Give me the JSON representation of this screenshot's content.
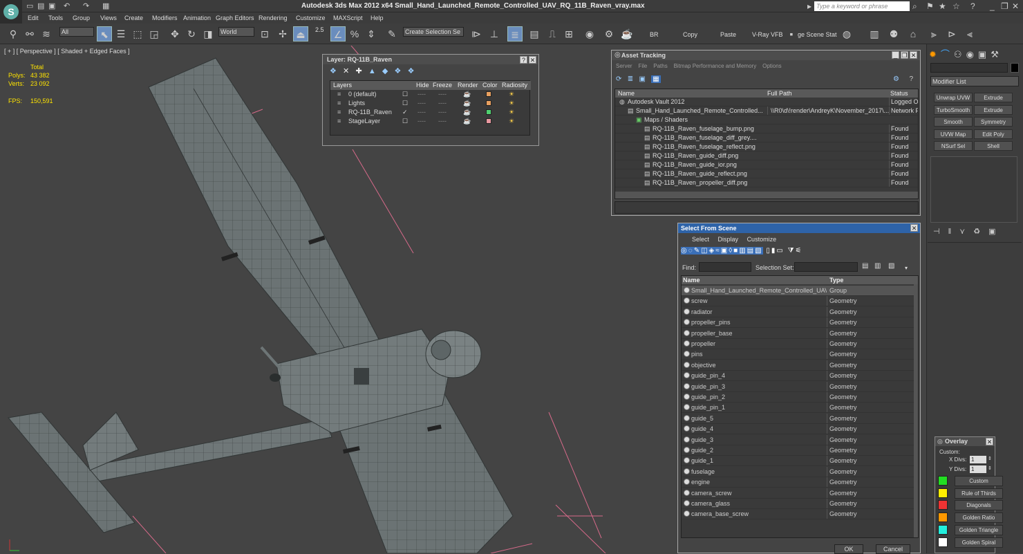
{
  "app": {
    "title": "Autodesk 3ds Max  2012 x64     Small_Hand_Launched_Remote_Controlled_UAV_RQ_11B_Raven_vray.max",
    "search_placeholder": "Type a keyword or phrase"
  },
  "menu": [
    "Edit",
    "Tools",
    "Group",
    "Views",
    "Create",
    "Modifiers",
    "Animation",
    "Graph Editors",
    "Rendering",
    "Customize",
    "MAXScript",
    "Help"
  ],
  "toolbar": {
    "filter_value": "All",
    "coord_value": "World",
    "snap_value": "2.5",
    "selection_set_value": "Create Selection Se",
    "br_label": "BR",
    "copy_label": "Copy",
    "paste_label": "Paste",
    "vray_vfb_label": "V-Ray VFB",
    "image_scene_label": "ge Scene Stat"
  },
  "viewport": {
    "label": "[ + ] [ Perspective ] [ Shaded + Edged Faces ]",
    "total_label": "Total",
    "polys_label": "Polys:",
    "polys_value": "43 382",
    "verts_label": "Verts:",
    "verts_value": "23 092",
    "fps_label": "FPS:",
    "fps_value": "150,591"
  },
  "layer_window": {
    "title": "Layer: RQ-11B_Raven",
    "columns": [
      "Layers",
      "Hide",
      "Freeze",
      "Render",
      "Color",
      "Radiosity"
    ],
    "rows": [
      {
        "name": "0 (default)",
        "color": "#e8a060",
        "check": "☐"
      },
      {
        "name": "Lights",
        "color": "#e8a060",
        "check": "☐"
      },
      {
        "name": "RQ-11B_Raven",
        "color": "#50d070",
        "check": "✓"
      },
      {
        "name": "StageLayer",
        "color": "#e898a0",
        "check": "☐"
      }
    ]
  },
  "asset_tracking": {
    "title": "Asset Tracking",
    "menu": [
      "Server",
      "File",
      "Paths",
      "Bitmap Performance and Memory",
      "Options"
    ],
    "columns": [
      "Name",
      "Full Path",
      "Status"
    ],
    "rows": [
      {
        "name": "Autodesk Vault 2012",
        "path": "",
        "status": "Logged Ou"
      },
      {
        "name": "Small_Hand_Launched_Remote_Controlled....",
        "path": "\\\\R0\\d\\!render\\AndreyK\\November_2017\\...",
        "status": "Network Pa"
      },
      {
        "name": "Maps / Shaders",
        "path": "",
        "status": ""
      },
      {
        "name": "RQ-11B_Raven_fuselage_bump.png",
        "path": "",
        "status": "Found"
      },
      {
        "name": "RQ-11B_Raven_fuselage_diff_grey....",
        "path": "",
        "status": "Found"
      },
      {
        "name": "RQ-11B_Raven_fuselage_reflect.png",
        "path": "",
        "status": "Found"
      },
      {
        "name": "RQ-11B_Raven_guide_diff.png",
        "path": "",
        "status": "Found"
      },
      {
        "name": "RQ-11B_Raven_guide_ior.png",
        "path": "",
        "status": "Found"
      },
      {
        "name": "RQ-11B_Raven_guide_reflect.png",
        "path": "",
        "status": "Found"
      },
      {
        "name": "RQ-11B_Raven_propeller_diff.png",
        "path": "",
        "status": "Found"
      }
    ]
  },
  "select_scene": {
    "title": "Select From Scene",
    "menu": [
      "Select",
      "Display",
      "Customize"
    ],
    "find_label": "Find:",
    "selection_set_label": "Selection Set:",
    "col_name": "Name",
    "col_type": "Type",
    "rows": [
      {
        "name": "Small_Hand_Launched_Remote_Controlled_UAV_...",
        "type": "Group"
      },
      {
        "name": "screw",
        "type": "Geometry"
      },
      {
        "name": "radiator",
        "type": "Geometry"
      },
      {
        "name": "propeller_pins",
        "type": "Geometry"
      },
      {
        "name": "propeller_base",
        "type": "Geometry"
      },
      {
        "name": "propeller",
        "type": "Geometry"
      },
      {
        "name": "pins",
        "type": "Geometry"
      },
      {
        "name": "objective",
        "type": "Geometry"
      },
      {
        "name": "guide_pin_4",
        "type": "Geometry"
      },
      {
        "name": "guide_pin_3",
        "type": "Geometry"
      },
      {
        "name": "guide_pin_2",
        "type": "Geometry"
      },
      {
        "name": "guide_pin_1",
        "type": "Geometry"
      },
      {
        "name": "guide_5",
        "type": "Geometry"
      },
      {
        "name": "guide_4",
        "type": "Geometry"
      },
      {
        "name": "guide_3",
        "type": "Geometry"
      },
      {
        "name": "guide_2",
        "type": "Geometry"
      },
      {
        "name": "guide_1",
        "type": "Geometry"
      },
      {
        "name": "fuselage",
        "type": "Geometry"
      },
      {
        "name": "engine",
        "type": "Geometry"
      },
      {
        "name": "camera_screw",
        "type": "Geometry"
      },
      {
        "name": "camera_glass",
        "type": "Geometry"
      },
      {
        "name": "camera_base_screw",
        "type": "Geometry"
      }
    ],
    "ok_label": "OK",
    "cancel_label": "Cancel"
  },
  "command_panel": {
    "modifier_list": "Modifier List",
    "buttons": [
      "Unwrap UVW",
      "Extrude",
      "TurboSmooth",
      "Extrude",
      "Smooth",
      "Symmetry",
      "UVW Map",
      "Edit Poly",
      "NSurf Sel",
      "Shell"
    ]
  },
  "overlay": {
    "title": "Overlay",
    "custom_label": "Custom:",
    "xdivs_label": "X Divs:",
    "xdivs_value": "1",
    "ydivs_label": "Y Divs:",
    "ydivs_value": "1",
    "items": [
      {
        "label": "Custom",
        "color": "#22dd22"
      },
      {
        "label": "Rule of Thirds",
        "color": "#ffee00"
      },
      {
        "label": "Diagonals",
        "color": "#ee3333"
      },
      {
        "label": "Golden Ratio",
        "color": "#ff9900"
      },
      {
        "label": "Golden Triangle",
        "color": "#22eedd"
      },
      {
        "label": "Golden Spiral",
        "color": "#ffffff"
      }
    ]
  }
}
